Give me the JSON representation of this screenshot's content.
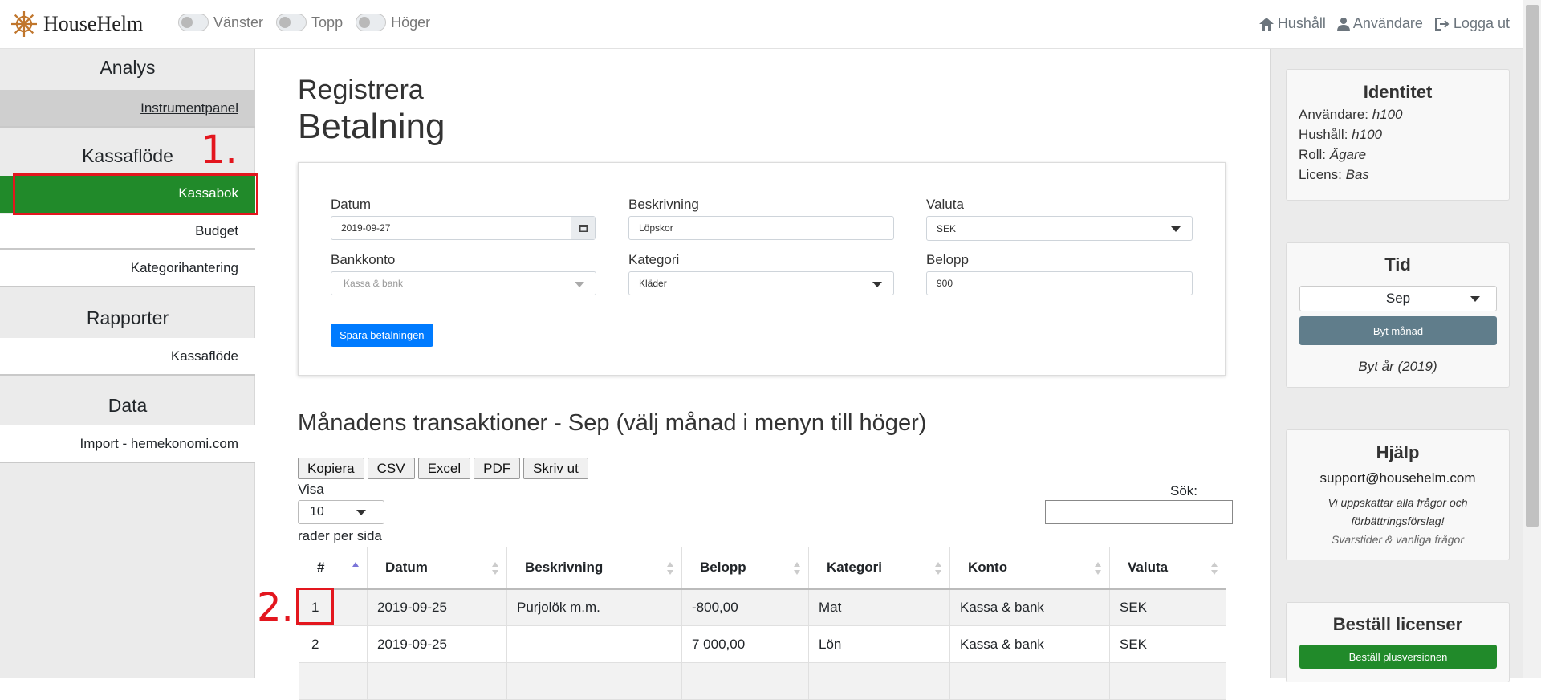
{
  "app": {
    "brand": "HouseHelm"
  },
  "toggles": [
    {
      "label": "Vänster"
    },
    {
      "label": "Topp"
    },
    {
      "label": "Höger"
    }
  ],
  "topnav": {
    "household": "Hushåll",
    "users": "Användare",
    "logout": "Logga ut"
  },
  "sidebar": {
    "sections": [
      {
        "title": "Analys",
        "items": [
          "Instrumentpanel"
        ]
      },
      {
        "title": "Kassaflöde",
        "items": [
          "Kassabok",
          "Budget",
          "Kategorihantering"
        ]
      },
      {
        "title": "Rapporter",
        "items": [
          "Kassaflöde"
        ]
      },
      {
        "title": "Data",
        "items": [
          "Import - hemekonomi.com"
        ]
      }
    ]
  },
  "page": {
    "title_small": "Registrera",
    "title_big": "Betalning"
  },
  "form": {
    "date_label": "Datum",
    "date_value": "2019-09-27",
    "desc_label": "Beskrivning",
    "desc_value": "Löpskor",
    "currency_label": "Valuta",
    "currency_value": "SEK",
    "bank_label": "Bankkonto",
    "bank_value": "Kassa & bank",
    "category_label": "Kategori",
    "category_value": "Kläder",
    "amount_label": "Belopp",
    "amount_value": "900",
    "save_button": "Spara betalningen"
  },
  "transactions": {
    "title": "Månadens transaktioner - Sep (välj månad i menyn till höger)",
    "tool_buttons": [
      "Kopiera",
      "CSV",
      "Excel",
      "PDF",
      "Skriv ut"
    ],
    "show_label": "Visa",
    "page_size": "10",
    "rows_label": "rader per sida",
    "search_label": "Sök:",
    "columns": [
      "#",
      "Datum",
      "Beskrivning",
      "Belopp",
      "Kategori",
      "Konto",
      "Valuta"
    ],
    "rows": [
      [
        "1",
        "2019-09-25",
        "Purjolök m.m.",
        "-800,00",
        "Mat",
        "Kassa & bank",
        "SEK"
      ],
      [
        "2",
        "2019-09-25",
        "",
        "7 000,00",
        "Lön",
        "Kassa & bank",
        "SEK"
      ]
    ]
  },
  "identity": {
    "title": "Identitet",
    "user_label": "Användare:",
    "user_value": "h100",
    "household_label": "Hushåll:",
    "household_value": "h100",
    "role_label": "Roll:",
    "role_value": "Ägare",
    "license_label": "Licens:",
    "license_value": "Bas"
  },
  "time": {
    "title": "Tid",
    "month_value": "Sep",
    "switch_month": "Byt månad",
    "switch_year": "Byt år (2019)"
  },
  "help": {
    "title": "Hjälp",
    "email": "support@househelm.com",
    "line1": "Vi uppskattar alla frågor och",
    "line2": "förbättringsförslag!",
    "faq": "Svarstider & vanliga frågor"
  },
  "license": {
    "title": "Beställ licenser",
    "order_button": "Beställ plusversionen"
  },
  "annotations": {
    "a1": "1.",
    "a2": "2."
  },
  "colors": {
    "accent_green": "#218a2a",
    "primary_blue": "#007bff",
    "annotation_red": "#e3161e",
    "slate": "#607d8b"
  }
}
